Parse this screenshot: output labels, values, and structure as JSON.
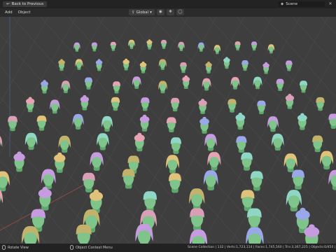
{
  "topbar": {
    "back_label": "Back to Previous",
    "scene_label": "Scene"
  },
  "header": {
    "menu_add": "Add",
    "menu_object": "Object",
    "orientation": "Global"
  },
  "status": {
    "left_label": "Rotate View",
    "mid_label": "Object Context Menu",
    "stats": "Scene Collection | 132 | Verts:1,723,114 | Faces:1,745,560 | Tris:3,367,225 | Objects:0/450 | "
  },
  "icons": {
    "back": "back-arrow-icon",
    "scene": "scene-icon",
    "close": "close-icon",
    "orientation": "transform-orientation-icon",
    "pivot": "pivot-point-icon",
    "snap": "snap-icon",
    "proportional": "proportional-editing-icon",
    "mouse_left": "mouse-left-icon",
    "mouse_right": "mouse-right-icon"
  },
  "colors": {
    "viewport_bg": "#3e3e3e",
    "grid": "#4a4a4a",
    "head": "#7fc48a",
    "hair_palette": [
      "#c79be0",
      "#e6a3b4",
      "#8fd6c6",
      "#e0c27a",
      "#9aa7e8",
      "#c3b26b",
      "#d99fb6"
    ]
  }
}
